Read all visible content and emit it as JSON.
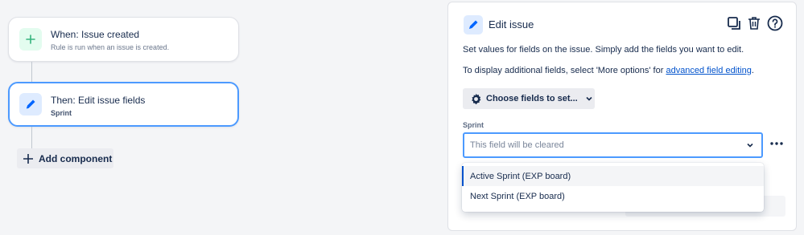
{
  "rule": {
    "trigger": {
      "title": "When: Issue created",
      "subtitle": "Rule is run when an issue is created."
    },
    "action": {
      "title": "Then: Edit issue fields",
      "subtitle": "Sprint"
    },
    "add_component_label": "Add component"
  },
  "panel": {
    "title": "Edit issue",
    "description": "Set values for fields on the issue. Simply add the fields you want to edit.",
    "hint_prefix": "To display additional fields, select 'More options' for ",
    "hint_link": "advanced field editing",
    "hint_suffix": ".",
    "choose_fields_label": "Choose fields to set...",
    "sprint_field": {
      "label": "Sprint",
      "value": "This field will be cleared"
    }
  },
  "dropdown": {
    "options": [
      {
        "label": "Active Sprint (EXP board)",
        "highlighted": true
      },
      {
        "label": "Next Sprint (EXP board)",
        "highlighted": false
      }
    ]
  },
  "colors": {
    "accent": "#4c9aff",
    "link": "#0052cc",
    "trigger_icon_bg": "#e3fcef",
    "trigger_icon": "#36b37e",
    "action_icon_bg": "#deebff",
    "action_icon": "#0065ff"
  },
  "icons": {
    "trigger": "plus-icon",
    "action": "pencil-icon",
    "panel_actions": [
      "copy-icon",
      "trash-icon",
      "help-icon"
    ],
    "choose_fields": "gear-icon",
    "select": "chevron-down-icon",
    "field_more": "more-horizontal-icon"
  }
}
